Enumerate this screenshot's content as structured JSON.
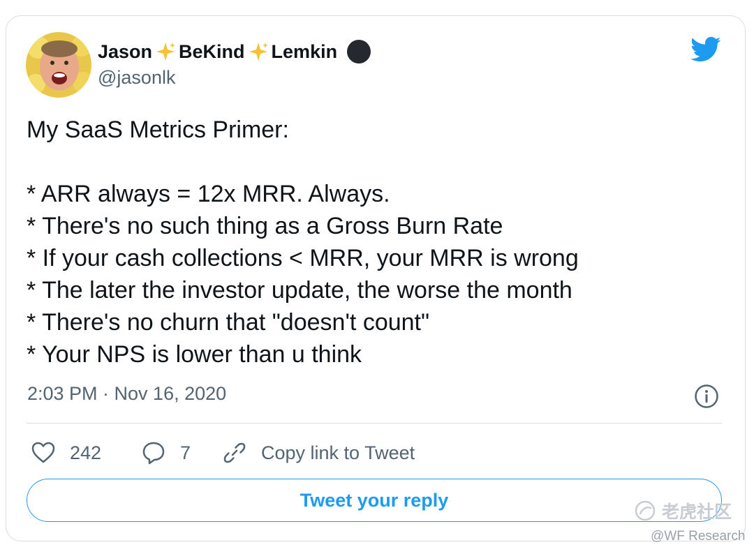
{
  "tweet": {
    "author": {
      "name_parts": [
        "Jason",
        "BeKind",
        "Lemkin"
      ],
      "handle": "@jasonlk"
    },
    "text": {
      "title": "My SaaS Metrics Primer:",
      "bullets": [
        "* ARR always = 12x MRR.  Always.",
        "* There's no such thing as a Gross Burn Rate",
        "* If your cash collections < MRR, your MRR is wrong",
        "* The later the investor update, the worse the month",
        "* There's no churn that \"doesn't count\"",
        "* Your NPS is lower than u think"
      ]
    },
    "timestamp": "2:03 PM · Nov 16, 2020",
    "actions": {
      "likes": "242",
      "replies": "7",
      "copy_link": "Copy link to Tweet"
    },
    "reply_button": "Tweet your reply"
  },
  "watermark": {
    "community": "老虎社区",
    "source": "@WF Research"
  },
  "colors": {
    "brand_blue": "#1d9bf0",
    "secondary_text": "#536471",
    "sparkle": "#f6c232"
  },
  "icons": [
    "avatar-photo",
    "sparkle-icon",
    "verified-dot-icon",
    "twitter-bird-icon",
    "info-icon",
    "heart-icon",
    "reply-icon",
    "link-icon"
  ]
}
